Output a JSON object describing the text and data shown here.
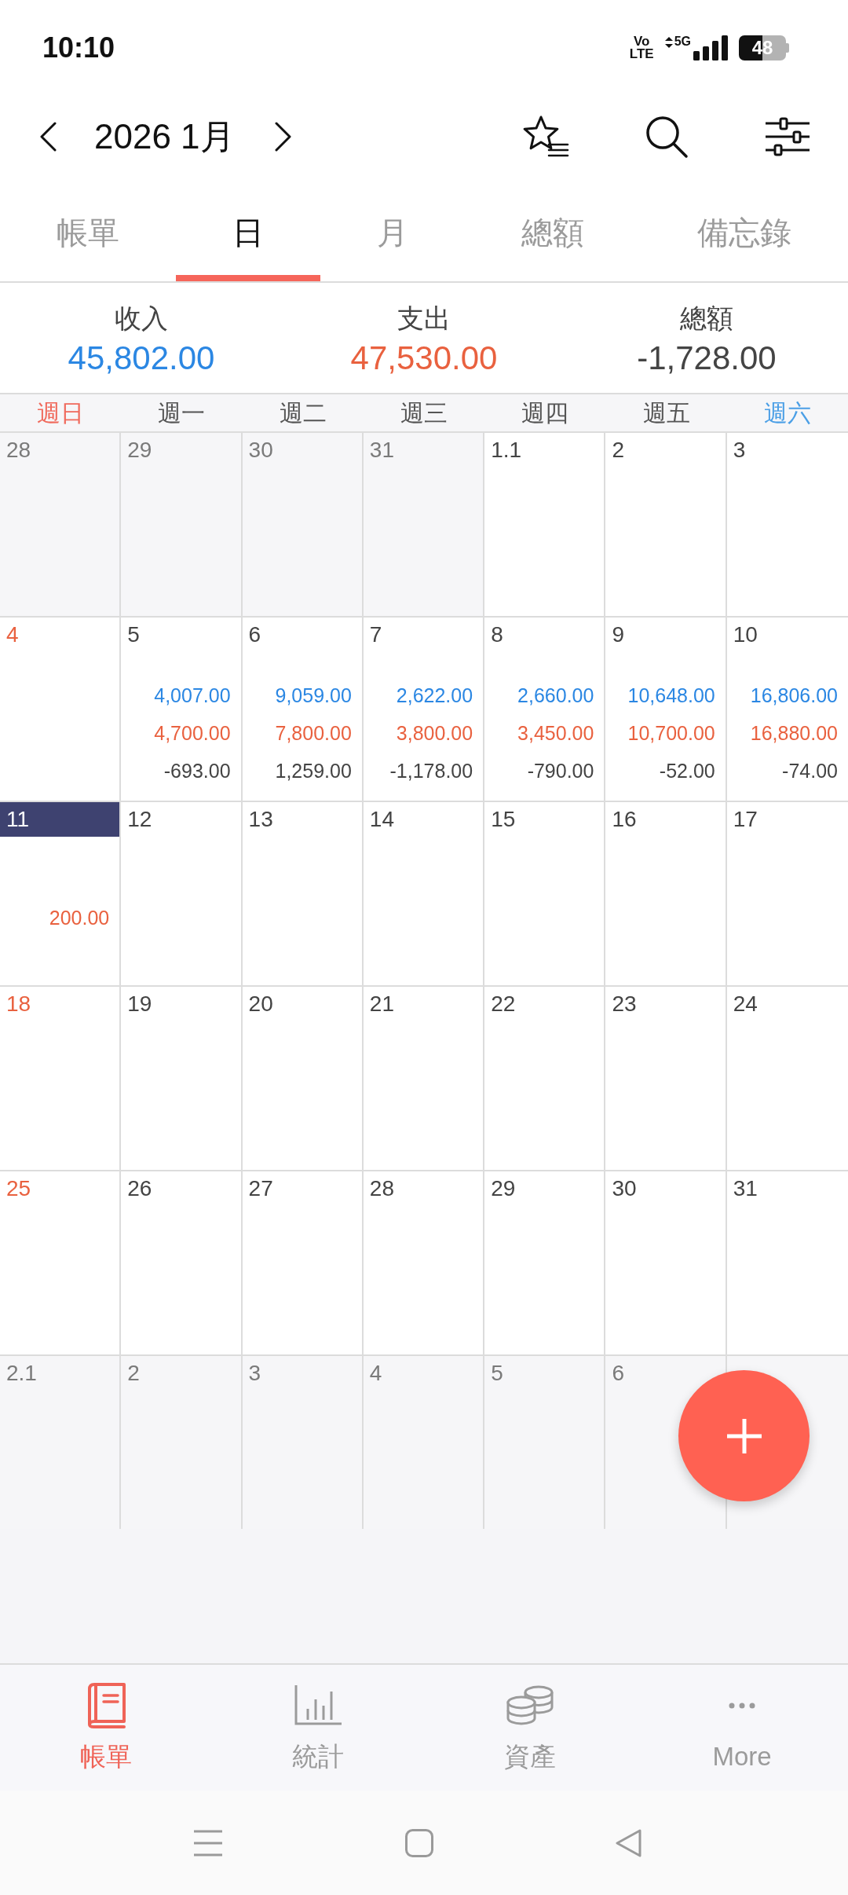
{
  "status_bar": {
    "time": "10:10",
    "volte": "Vo LTE",
    "network": "5G",
    "battery": "48"
  },
  "header": {
    "title": "2026 1月"
  },
  "tabs": [
    {
      "label": "帳單",
      "selected": false
    },
    {
      "label": "日",
      "selected": true
    },
    {
      "label": "月",
      "selected": false
    },
    {
      "label": "總額",
      "selected": false
    },
    {
      "label": "備忘錄",
      "selected": false
    }
  ],
  "summary": [
    {
      "kind": "income",
      "label": "收入",
      "value": "45,802.00"
    },
    {
      "kind": "expense",
      "label": "支出",
      "value": "47,530.00"
    },
    {
      "kind": "total",
      "label": "總額",
      "value": "-1,728.00"
    }
  ],
  "weekdays": [
    {
      "label": "週日",
      "kind": "sunday"
    },
    {
      "label": "週一",
      "kind": "weekday"
    },
    {
      "label": "週二",
      "kind": "weekday"
    },
    {
      "label": "週三",
      "kind": "weekday"
    },
    {
      "label": "週四",
      "kind": "weekday"
    },
    {
      "label": "週五",
      "kind": "weekday"
    },
    {
      "label": "週六",
      "kind": "saturday"
    }
  ],
  "calendar": {
    "weeks": [
      [
        {
          "day": "28",
          "in_month": false,
          "selected": false
        },
        {
          "day": "29",
          "in_month": false,
          "selected": false
        },
        {
          "day": "30",
          "in_month": false,
          "selected": false
        },
        {
          "day": "31",
          "in_month": false,
          "selected": false
        },
        {
          "day": "1.1",
          "in_month": true,
          "selected": false
        },
        {
          "day": "2",
          "in_month": true,
          "selected": false
        },
        {
          "day": "3",
          "in_month": true,
          "selected": false
        }
      ],
      [
        {
          "day": "4",
          "in_month": true,
          "selected": false
        },
        {
          "day": "5",
          "in_month": true,
          "selected": false,
          "income": "4,007.00",
          "expense": "4,700.00",
          "total": "-693.00"
        },
        {
          "day": "6",
          "in_month": true,
          "selected": false,
          "income": "9,059.00",
          "expense": "7,800.00",
          "total": "1,259.00"
        },
        {
          "day": "7",
          "in_month": true,
          "selected": false,
          "income": "2,622.00",
          "expense": "3,800.00",
          "total": "-1,178.00"
        },
        {
          "day": "8",
          "in_month": true,
          "selected": false,
          "income": "2,660.00",
          "expense": "3,450.00",
          "total": "-790.00"
        },
        {
          "day": "9",
          "in_month": true,
          "selected": false,
          "income": "10,648.00",
          "expense": "10,700.00",
          "total": "-52.00"
        },
        {
          "day": "10",
          "in_month": true,
          "selected": false,
          "income": "16,806.00",
          "expense": "16,880.00",
          "total": "-74.00"
        }
      ],
      [
        {
          "day": "11",
          "in_month": true,
          "selected": true,
          "expense": "200.00"
        },
        {
          "day": "12",
          "in_month": true,
          "selected": false
        },
        {
          "day": "13",
          "in_month": true,
          "selected": false
        },
        {
          "day": "14",
          "in_month": true,
          "selected": false
        },
        {
          "day": "15",
          "in_month": true,
          "selected": false
        },
        {
          "day": "16",
          "in_month": true,
          "selected": false
        },
        {
          "day": "17",
          "in_month": true,
          "selected": false
        }
      ],
      [
        {
          "day": "18",
          "in_month": true,
          "selected": false
        },
        {
          "day": "19",
          "in_month": true,
          "selected": false
        },
        {
          "day": "20",
          "in_month": true,
          "selected": false
        },
        {
          "day": "21",
          "in_month": true,
          "selected": false
        },
        {
          "day": "22",
          "in_month": true,
          "selected": false
        },
        {
          "day": "23",
          "in_month": true,
          "selected": false
        },
        {
          "day": "24",
          "in_month": true,
          "selected": false
        }
      ],
      [
        {
          "day": "25",
          "in_month": true,
          "selected": false
        },
        {
          "day": "26",
          "in_month": true,
          "selected": false
        },
        {
          "day": "27",
          "in_month": true,
          "selected": false
        },
        {
          "day": "28",
          "in_month": true,
          "selected": false
        },
        {
          "day": "29",
          "in_month": true,
          "selected": false
        },
        {
          "day": "30",
          "in_month": true,
          "selected": false
        },
        {
          "day": "31",
          "in_month": true,
          "selected": false
        }
      ],
      [
        {
          "day": "2.1",
          "in_month": false,
          "selected": false
        },
        {
          "day": "2",
          "in_month": false,
          "selected": false
        },
        {
          "day": "3",
          "in_month": false,
          "selected": false
        },
        {
          "day": "4",
          "in_month": false,
          "selected": false
        },
        {
          "day": "5",
          "in_month": false,
          "selected": false
        },
        {
          "day": "6",
          "in_month": false,
          "selected": false
        }
      ]
    ]
  },
  "bottom_nav": [
    {
      "label": "帳單",
      "selected": true
    },
    {
      "label": "統計",
      "selected": false
    },
    {
      "label": "資產",
      "selected": false
    },
    {
      "label": "More",
      "selected": false
    }
  ]
}
